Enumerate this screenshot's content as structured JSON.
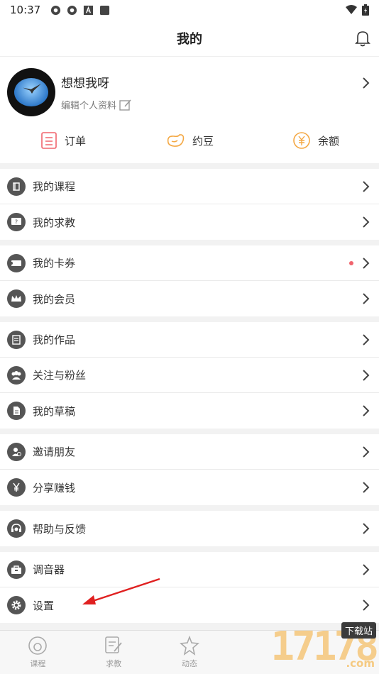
{
  "status_bar": {
    "time": "10:37"
  },
  "header": {
    "title": "我的"
  },
  "profile": {
    "username": "想想我呀",
    "edit_label": "编辑个人资料"
  },
  "quick_links": [
    {
      "label": "订单",
      "icon": "order-icon"
    },
    {
      "label": "约豆",
      "icon": "bean-icon"
    },
    {
      "label": "余额",
      "icon": "balance-icon"
    }
  ],
  "sections": [
    [
      {
        "label": "我的课程",
        "icon": "book-icon"
      },
      {
        "label": "我的求教",
        "icon": "question-icon"
      }
    ],
    [
      {
        "label": "我的卡券",
        "icon": "ticket-icon",
        "has_dot": true
      },
      {
        "label": "我的会员",
        "icon": "crown-icon"
      }
    ],
    [
      {
        "label": "我的作品",
        "icon": "works-icon"
      },
      {
        "label": "关注与粉丝",
        "icon": "people-icon"
      },
      {
        "label": "我的草稿",
        "icon": "draft-icon"
      }
    ],
    [
      {
        "label": "邀请朋友",
        "icon": "invite-icon"
      },
      {
        "label": "分享赚钱",
        "icon": "yen-icon"
      }
    ],
    [
      {
        "label": "帮助与反馈",
        "icon": "headset-icon"
      }
    ],
    [
      {
        "label": "调音器",
        "icon": "toolbox-icon"
      },
      {
        "label": "设置",
        "icon": "gear-icon"
      }
    ]
  ],
  "bottom_nav": [
    {
      "label": "课程",
      "icon": "course-icon"
    },
    {
      "label": "求教",
      "icon": "ask-icon"
    },
    {
      "label": "动态",
      "icon": "star-icon"
    }
  ],
  "watermark": {
    "number": "17178",
    "badge": "下载站",
    "suffix": ".com"
  },
  "colors": {
    "accent_red": "#f0646d",
    "accent_orange": "#f4a844",
    "icon_gray": "#555555"
  }
}
